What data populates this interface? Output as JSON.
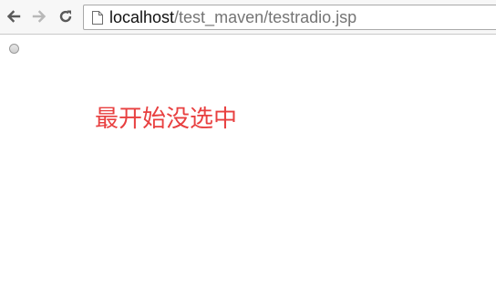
{
  "browser": {
    "url_host": "localhost",
    "url_path": "/test_maven/testradio.jsp",
    "icons": {
      "back": "back-arrow-icon",
      "forward": "forward-arrow-icon",
      "reload": "reload-icon",
      "page": "page-icon"
    }
  },
  "page": {
    "radio": {
      "checked": false
    },
    "notice_text": "最开始没选中",
    "notice_color": "#e84040"
  }
}
